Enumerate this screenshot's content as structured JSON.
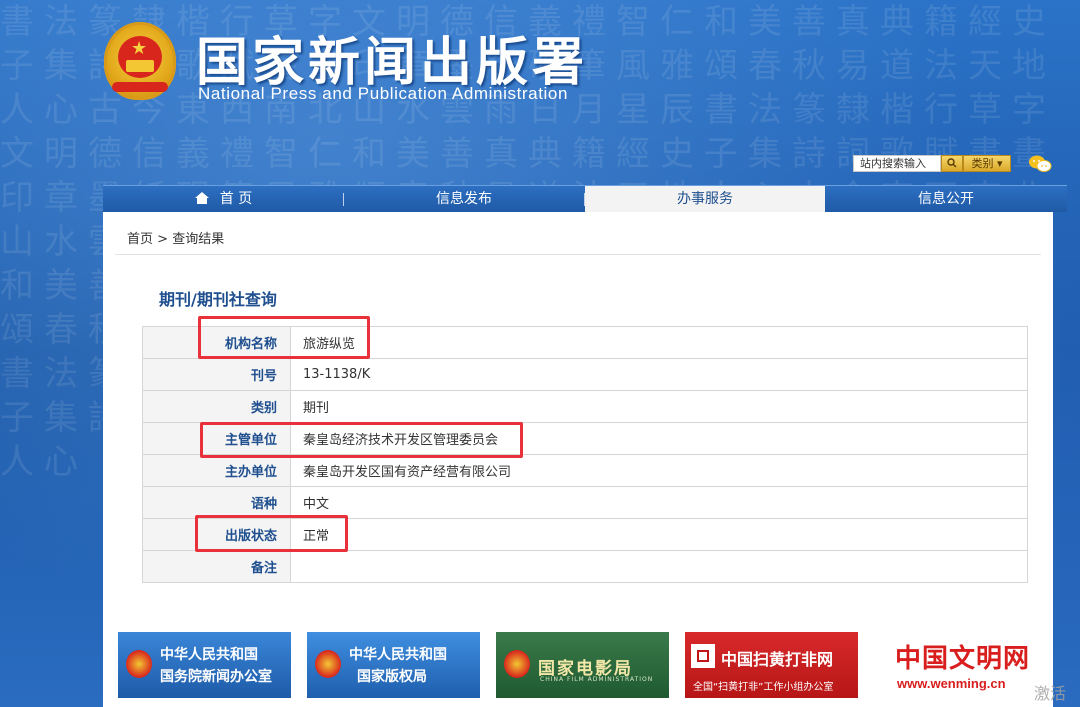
{
  "header": {
    "title_cn": "国家新闻出版署",
    "title_en": "National  Press and Publication Administration",
    "search_placeholder": "站内搜索输入",
    "category_label": "类别"
  },
  "nav": {
    "items": [
      {
        "label": "首 页",
        "active": false
      },
      {
        "label": "信息发布",
        "active": false
      },
      {
        "label": "办事服务",
        "active": true
      },
      {
        "label": "信息公开",
        "active": false
      }
    ]
  },
  "breadcrumb": {
    "home": "首页",
    "separator": ">",
    "current": "查询结果"
  },
  "page_title": "期刊/期刊社查询",
  "record": {
    "rows": [
      {
        "label": "机构名称",
        "value": "旅游纵览"
      },
      {
        "label": "刊号",
        "value": "13-1138/K"
      },
      {
        "label": "类别",
        "value": "期刊"
      },
      {
        "label": "主管单位",
        "value": "秦皇岛经济技术开发区管理委员会"
      },
      {
        "label": "主办单位",
        "value": "秦皇岛开发区国有资产经营有限公司"
      },
      {
        "label": "语种",
        "value": "中文"
      },
      {
        "label": "出版状态",
        "value": "正常"
      },
      {
        "label": "备注",
        "value": ""
      }
    ]
  },
  "banners": [
    {
      "line1": "中华人民共和国",
      "line2": "国务院新闻办公室"
    },
    {
      "line1": "中华人民共和国",
      "line2": "国家版权局"
    },
    {
      "line1": "国家电影局",
      "sub": "CHINA FILM ADMINISTRATION"
    },
    {
      "line1": "中国扫黄打非网",
      "sub": "全国“扫黄打非”工作小组办公室"
    },
    {
      "line1": "中国文明网",
      "line2": "www.wenming.cn"
    }
  ],
  "watermark": "激活",
  "colors": {
    "accent_blue": "#1f4f8f",
    "highlight_red": "#e8313a",
    "nav_blue": "#2d6fc2"
  }
}
